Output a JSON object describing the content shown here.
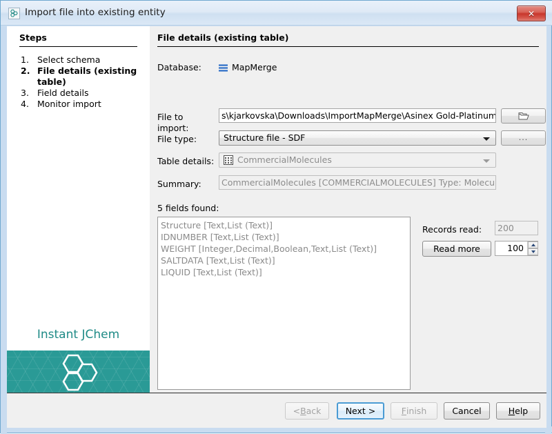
{
  "window": {
    "title": "Import file into existing entity",
    "icon": "hexagon-cluster-icon",
    "close_label": "✕"
  },
  "steps": {
    "heading": "Steps",
    "items": [
      {
        "num": "1.",
        "label": "Select schema",
        "current": false
      },
      {
        "num": "2.",
        "label": "File details (existing table)",
        "current": true
      },
      {
        "num": "3.",
        "label": "Field details",
        "current": false
      },
      {
        "num": "4.",
        "label": "Monitor import",
        "current": false
      }
    ]
  },
  "branding": {
    "product_name": "Instant JChem"
  },
  "content": {
    "heading": "File details (existing table)",
    "labels": {
      "database": "Database:",
      "file_to_import": "File to import:",
      "file_type": "File type:",
      "table_details": "Table details:",
      "summary": "Summary:"
    },
    "database": {
      "name": "MapMerge",
      "icon": "database-lines-icon"
    },
    "file_to_import": {
      "value": "s\\kjarkovska\\Downloads\\ImportMapMerge\\Asinex Gold-Platinum.sdf",
      "browse_button_icon": "folder-open-icon"
    },
    "file_type": {
      "value": "Structure file - SDF",
      "options_button_label": "..."
    },
    "table_details": {
      "value": "CommercialMolecules",
      "icon": "table-grid-icon"
    },
    "summary": {
      "value": "CommercialMolecules [COMMERCIALMOLECULES] Type: Molecules"
    },
    "fields": {
      "caption": "5 fields found:",
      "items": [
        "Structure [Text,List (Text)]",
        "IDNUMBER [Text,List (Text)]",
        "WEIGHT [Integer,Decimal,Boolean,Text,List (Text)]",
        "SALTDATA [Text,List (Text)]",
        "LIQUID [Text,List (Text)]"
      ]
    },
    "records": {
      "label": "Records read:",
      "value": "200",
      "read_more_label": "Read more",
      "count_value": "100"
    }
  },
  "footer": {
    "back": {
      "pre": "< ",
      "mnemonic": "B",
      "post": "ack",
      "disabled": true
    },
    "next": {
      "pre": "",
      "mnemonic": "",
      "post": "Next >",
      "disabled": false,
      "default": true
    },
    "finish": {
      "pre": "",
      "mnemonic": "F",
      "post": "inish",
      "disabled": true
    },
    "cancel": {
      "pre": "",
      "mnemonic": "",
      "post": "Cancel",
      "disabled": false
    },
    "help": {
      "pre": "",
      "mnemonic": "H",
      "post": "elp",
      "disabled": false
    }
  },
  "colors": {
    "brand_teal": "#2a9a96",
    "brand_text": "#1e8a86",
    "accent_blue": "#1a62c4",
    "default_button_border": "#4a9bd4",
    "close_red": "#c8372c"
  }
}
